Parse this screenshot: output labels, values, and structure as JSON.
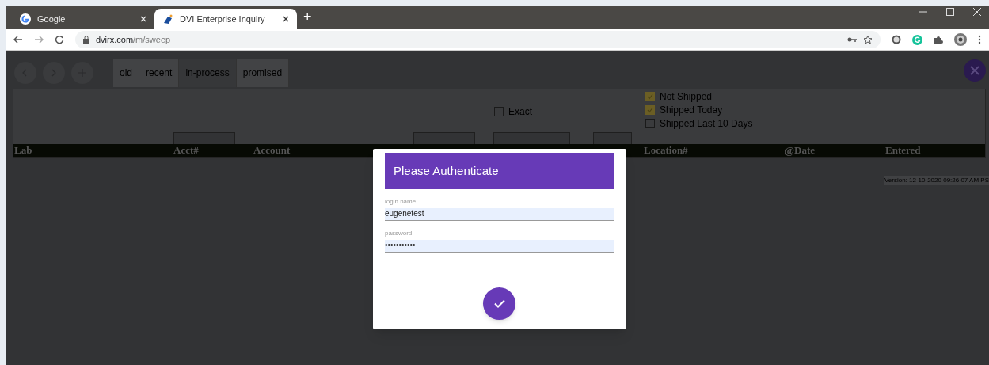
{
  "browser": {
    "tabs": [
      {
        "title": "Google",
        "selected": false,
        "kind": "google"
      },
      {
        "title": "DVI Enterprise Inquiry",
        "selected": true,
        "kind": "app"
      }
    ],
    "new_tab": "+",
    "url_host": "dvirx.com",
    "url_path": "/m/sweep"
  },
  "view_tabs": [
    {
      "label": "old",
      "selected": false
    },
    {
      "label": "recent",
      "selected": false
    },
    {
      "label": "in-process",
      "selected": true
    },
    {
      "label": "promised",
      "selected": false
    }
  ],
  "exact": {
    "label": "Exact",
    "checked": false
  },
  "status_filters": [
    {
      "label": "Not Shipped",
      "checked": true
    },
    {
      "label": "Shipped Today",
      "checked": true
    },
    {
      "label": "Shipped Last 10 Days",
      "checked": false
    }
  ],
  "columns": [
    "Lab",
    "Acct#",
    "Account",
    "Location#",
    "@Date",
    "Entered"
  ],
  "version": "Version: 12-10-2020 09:26:07 AM PS",
  "dialog": {
    "title": "Please Authenticate",
    "fields": [
      {
        "label": "login name",
        "value": "eugenetest"
      },
      {
        "label": "password",
        "value": "•••••••••••"
      }
    ]
  }
}
